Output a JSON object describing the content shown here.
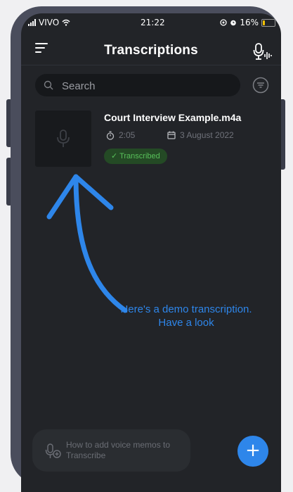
{
  "status_bar": {
    "carrier": "VIVO",
    "time": "21:22",
    "battery": "16%",
    "battery_level": 0.16
  },
  "header": {
    "title": "Transcriptions",
    "menu_icon": "menu-lines-icon",
    "record_icon": "microphone-waveform-icon"
  },
  "search": {
    "placeholder": "Search",
    "icon": "search-icon",
    "filter_icon": "filter-icon"
  },
  "recordings": [
    {
      "title": "Court Interview Example.m4a",
      "duration": "2:05",
      "date": "3 August 2022",
      "status": "✓ Transcribed",
      "thumb_icon": "microphone-icon"
    }
  ],
  "annotation": {
    "text": "Here's a demo transcription. Have a look",
    "color": "#2e86ea"
  },
  "help": {
    "text": "How to add voice memos to Transcribe",
    "icon": "microphone-plus-icon"
  },
  "fab": {
    "label": "+",
    "color": "#2e86ea"
  },
  "colors": {
    "background": "#222428",
    "badge_bg": "#244a25",
    "badge_text": "#58c05a",
    "accent": "#2e86ea"
  }
}
